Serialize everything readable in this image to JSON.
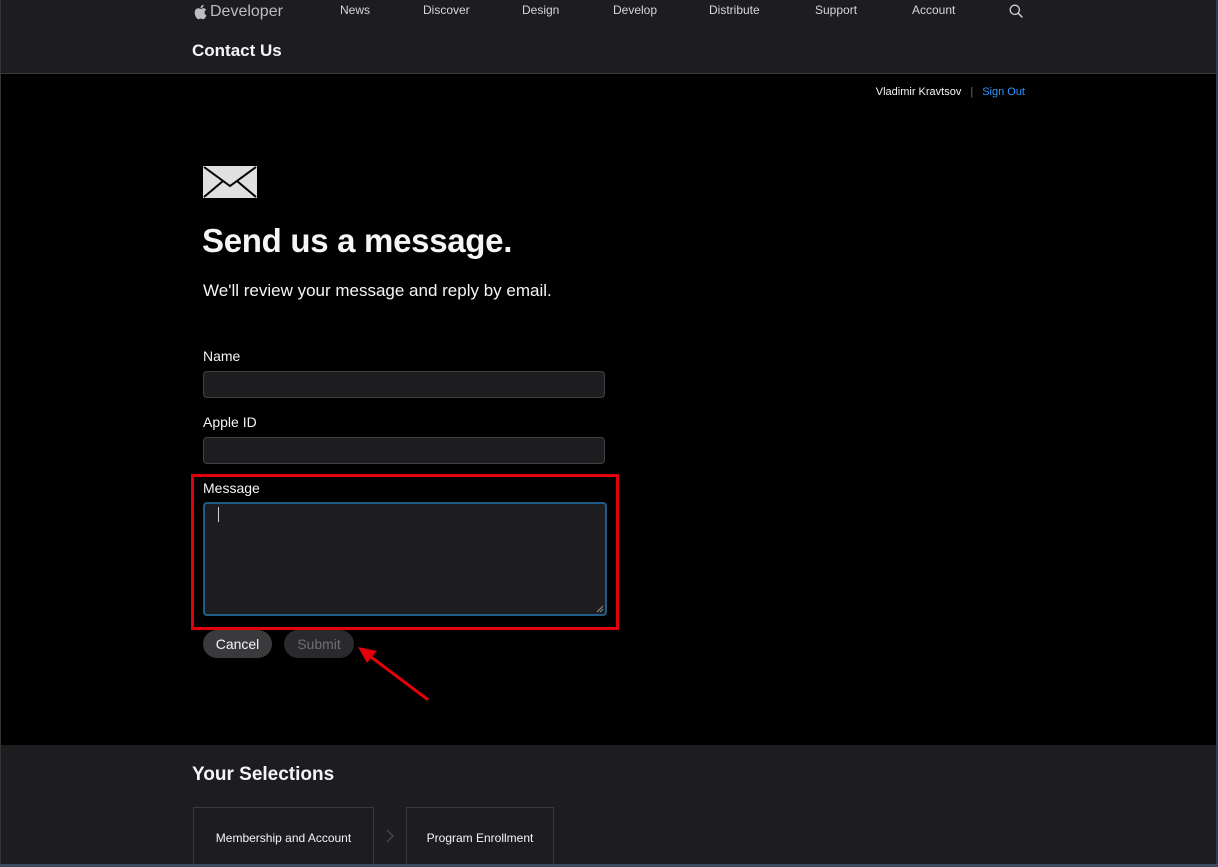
{
  "globalnav": {
    "brand": "Developer",
    "links": [
      "News",
      "Discover",
      "Design",
      "Develop",
      "Distribute",
      "Support",
      "Account"
    ]
  },
  "localnav": {
    "title": "Contact Us"
  },
  "user": {
    "name": "Vladimir Kravtsov",
    "separator": "|",
    "sign_out": "Sign Out"
  },
  "main": {
    "headline": "Send us a message.",
    "subhead": "We'll review your message and reply by email.",
    "form": {
      "name_label": "Name",
      "name_value": "",
      "apple_id_label": "Apple ID",
      "apple_id_value": "",
      "message_label": "Message",
      "message_value": "",
      "cancel_label": "Cancel",
      "submit_label": "Submit"
    }
  },
  "selections": {
    "title": "Your Selections",
    "items": [
      "Membership and Account",
      "Program Enrollment"
    ]
  },
  "icons": {
    "brand": "apple-logo-icon",
    "search": "search-icon",
    "mail": "envelope-icon",
    "chevron": "chevron-right-icon",
    "annotation_arrow": "red-arrow-icon"
  },
  "colors": {
    "link": "#2997ff",
    "annotation": "#e3000b",
    "focus_border": "#1f5d86"
  }
}
